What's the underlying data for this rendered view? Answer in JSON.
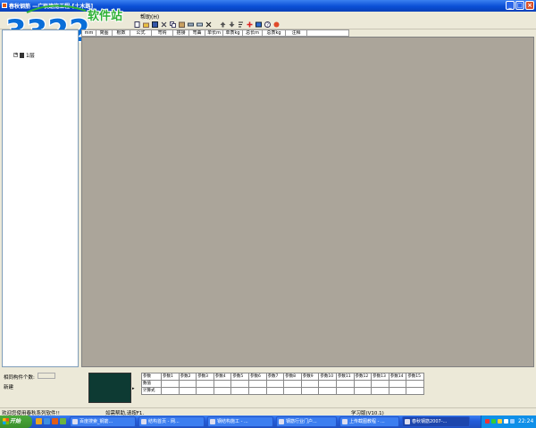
{
  "window": {
    "title": "春秋钢筋  —广联建施工程-[土木路]",
    "buttons": {
      "minimize": "_",
      "maximize": "□",
      "close": "×"
    }
  },
  "menu": {
    "help": "帮助(H)"
  },
  "watermark": {
    "site_number": "3322",
    "site_domain": ".cc",
    "site_tag": "软件站"
  },
  "grid_header": {
    "columns": [
      "mm",
      "简图",
      "根数",
      "公式",
      "弯钩",
      "搭接",
      "弯曲",
      "单长m",
      "单质kg",
      "总长m",
      "总质kg",
      "注释"
    ]
  },
  "tree": {
    "root_label": "1层"
  },
  "left_form": {
    "count_label": "相同构件个数:",
    "new_label": "新建"
  },
  "params": {
    "header_label": "参数",
    "columns": [
      "参数1",
      "参数2",
      "参数3",
      "参数4",
      "参数5",
      "参数6",
      "参数7",
      "参数8",
      "参数9",
      "参数10",
      "参数11",
      "参数12",
      "参数13",
      "参数14",
      "参数15"
    ],
    "rows": [
      "数值",
      "计算式"
    ]
  },
  "status": {
    "welcome": "欢迎您使用春秋系列软件!!",
    "hint": "如需帮助,请按F1.",
    "edition": "学习版(V10.1)"
  },
  "taskbar": {
    "start": "开始",
    "tasks": [
      "百度搜索_钢筋...",
      "结构首页 - 网...",
      "钢结构施工 - ...",
      "钢筋行业门户...",
      "上传截图教程 - ...",
      "春秋钢筋2007-..."
    ],
    "clock": "22:24"
  }
}
